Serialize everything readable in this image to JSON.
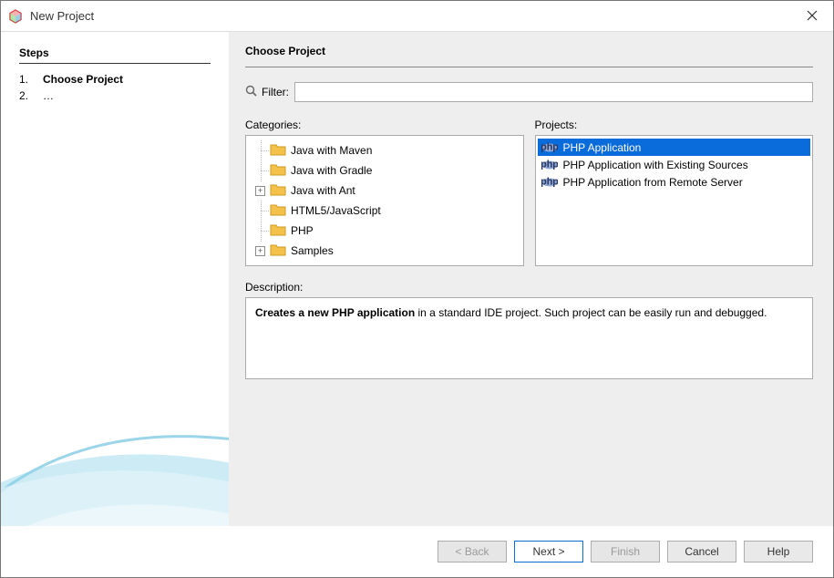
{
  "window": {
    "title": "New Project"
  },
  "sidebar": {
    "heading": "Steps",
    "steps": [
      {
        "num": "1.",
        "label": "Choose Project",
        "current": true
      },
      {
        "num": "2.",
        "label": "…",
        "current": false
      }
    ]
  },
  "pane": {
    "heading": "Choose Project",
    "filter": {
      "label": "Filter:",
      "value": ""
    },
    "categories_label": "Categories:",
    "projects_label": "Projects:",
    "categories": [
      {
        "label": "Java with Maven",
        "expandable": false
      },
      {
        "label": "Java with Gradle",
        "expandable": false
      },
      {
        "label": "Java with Ant",
        "expandable": true
      },
      {
        "label": "HTML5/JavaScript",
        "expandable": false
      },
      {
        "label": "PHP",
        "expandable": false
      },
      {
        "label": "Samples",
        "expandable": true
      }
    ],
    "projects": [
      {
        "label": "PHP Application",
        "selected": true
      },
      {
        "label": "PHP Application with Existing Sources",
        "selected": false
      },
      {
        "label": "PHP Application from Remote Server",
        "selected": false
      }
    ],
    "description_label": "Description:",
    "description_bold": "Creates a new PHP application",
    "description_rest": " in a standard IDE project. Such project can be easily run and debugged."
  },
  "buttons": {
    "back": "< Back",
    "next": "Next >",
    "finish": "Finish",
    "cancel": "Cancel",
    "help": "Help"
  }
}
